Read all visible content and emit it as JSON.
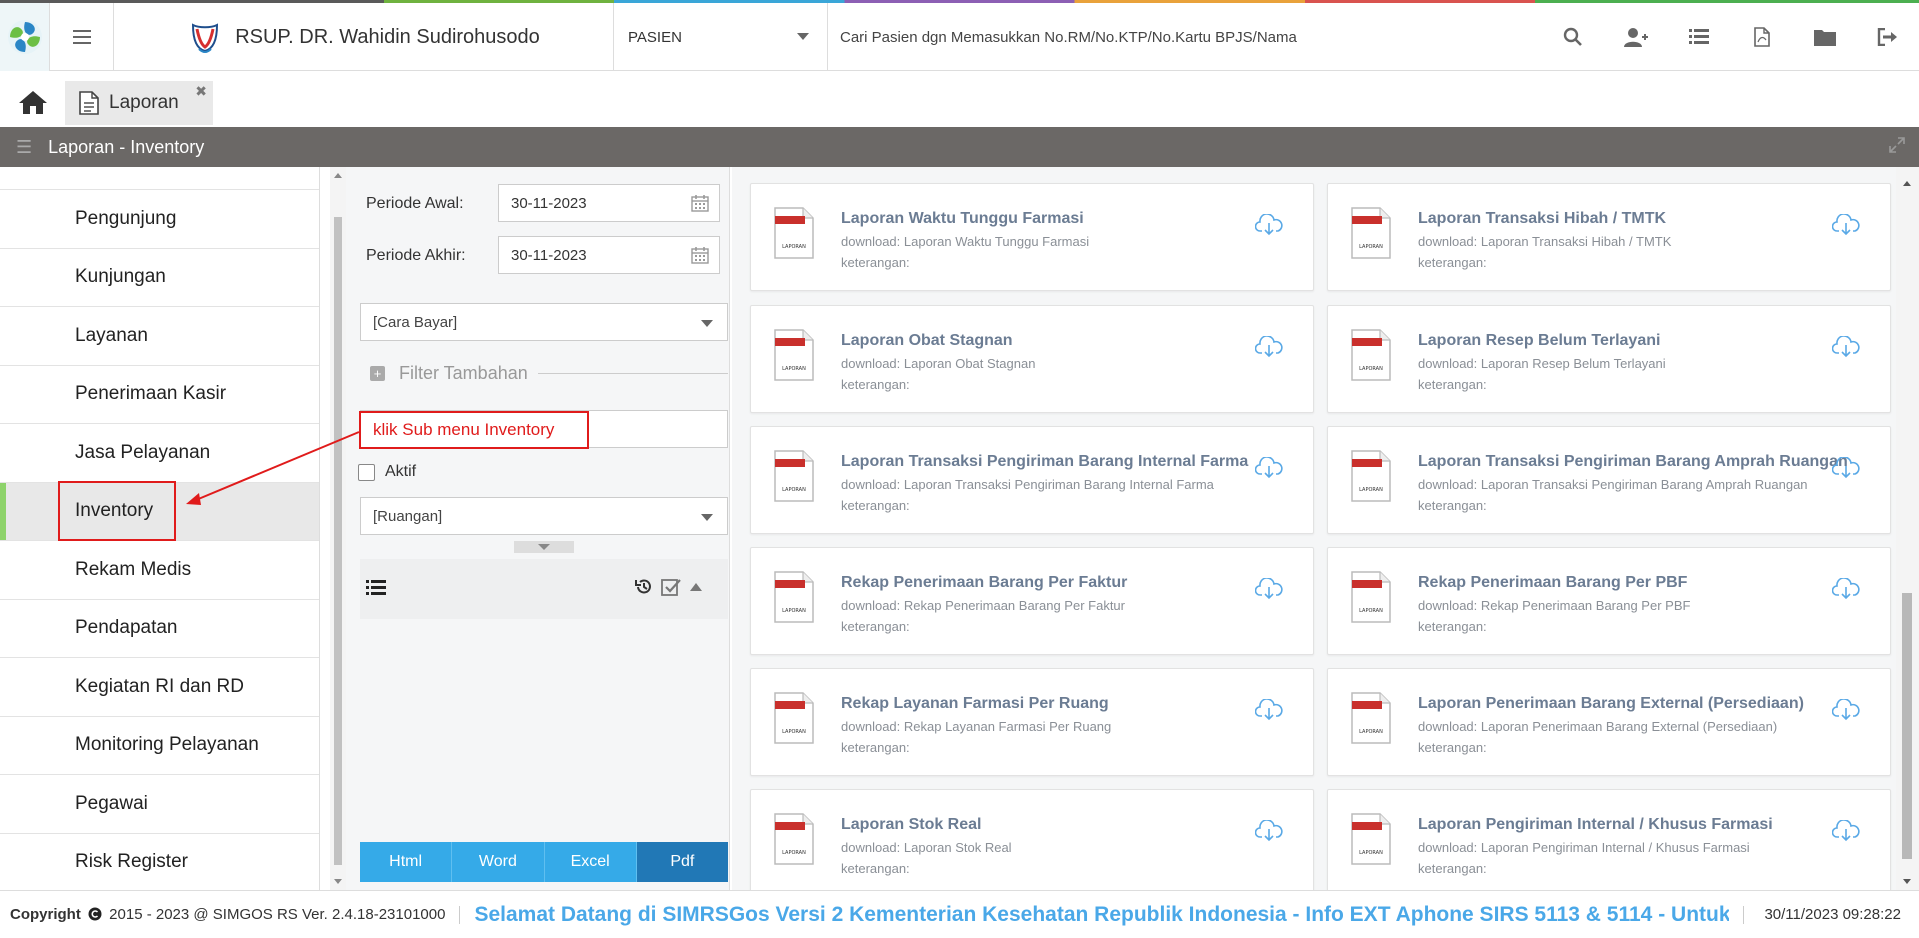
{
  "header": {
    "hospital_name": "RSUP. DR. Wahidin Sudirohusodo",
    "patient_type": "PASIEN",
    "search_placeholder": "Cari Pasien dgn Memasukkan No.RM/No.KTP/No.Kartu BPJS/Nama",
    "icons": [
      "search-icon",
      "add-user-icon",
      "list-icon",
      "pdf-file-icon",
      "folder-icon",
      "logout-icon"
    ]
  },
  "tabs": [
    {
      "label": "Laporan"
    }
  ],
  "page_title": "Laporan - Inventory",
  "sidebar": {
    "items": [
      {
        "label": "Pengunjung"
      },
      {
        "label": "Kunjungan"
      },
      {
        "label": "Layanan"
      },
      {
        "label": "Penerimaan Kasir"
      },
      {
        "label": "Jasa Pelayanan"
      },
      {
        "label": "Inventory"
      },
      {
        "label": "Rekam Medis"
      },
      {
        "label": "Pendapatan"
      },
      {
        "label": "Kegiatan RI dan RD"
      },
      {
        "label": "Monitoring Pelayanan"
      },
      {
        "label": "Pegawai"
      },
      {
        "label": "Risk Register"
      }
    ],
    "active": "Inventory"
  },
  "filters": {
    "periode_awal_label": "Periode Awal:",
    "periode_awal_value": "30-11-2023",
    "periode_akhir_label": "Periode Akhir:",
    "periode_akhir_value": "30-11-2023",
    "cara_bayar": "[Cara Bayar]",
    "filter_tambahan": "Filter Tambahan",
    "aktif_label": "Aktif",
    "ruangan": "[Ruangan]",
    "buttons": [
      "Html",
      "Word",
      "Excel",
      "Pdf"
    ]
  },
  "annotation": {
    "text": "klik Sub menu Inventory"
  },
  "reports": [
    {
      "title": "Laporan Waktu Tunggu Farmasi",
      "download": "download: Laporan Waktu Tunggu Farmasi",
      "keterangan": "keterangan:"
    },
    {
      "title": "Laporan Transaksi Hibah / TMTK",
      "download": "download: Laporan Transaksi Hibah / TMTK",
      "keterangan": "keterangan:"
    },
    {
      "title": "Laporan Obat Stagnan",
      "download": "download: Laporan Obat Stagnan",
      "keterangan": "keterangan:"
    },
    {
      "title": "Laporan Resep Belum Terlayani",
      "download": "download: Laporan Resep Belum Terlayani",
      "keterangan": "keterangan:"
    },
    {
      "title": "Laporan Transaksi Pengiriman Barang Internal Farma",
      "download": "download: Laporan Transaksi Pengiriman Barang Internal Farma",
      "keterangan": "keterangan:"
    },
    {
      "title": "Laporan Transaksi Pengiriman Barang Amprah Ruangan",
      "download": "download: Laporan Transaksi Pengiriman Barang Amprah Ruangan",
      "keterangan": "keterangan:"
    },
    {
      "title": "Rekap Penerimaan Barang Per Faktur",
      "download": "download: Rekap Penerimaan Barang Per Faktur",
      "keterangan": "keterangan:"
    },
    {
      "title": "Rekap Penerimaan Barang Per PBF",
      "download": "download: Rekap Penerimaan Barang Per PBF",
      "keterangan": "keterangan:"
    },
    {
      "title": "Rekap Layanan Farmasi Per Ruang",
      "download": "download: Rekap Layanan Farmasi Per Ruang",
      "keterangan": "keterangan:"
    },
    {
      "title": "Laporan Penerimaan Barang External (Persediaan)",
      "download": "download: Laporan Penerimaan Barang External (Persediaan)",
      "keterangan": "keterangan:"
    },
    {
      "title": "Laporan Stok Real",
      "download": "download: Laporan Stok Real",
      "keterangan": "keterangan:"
    },
    {
      "title": "Laporan Pengiriman Internal / Khusus Farmasi",
      "download": "download: Laporan Pengiriman Internal / Khusus Farmasi",
      "keterangan": "keterangan:"
    }
  ],
  "pdf_icon_text": "LAPORAN",
  "footer": {
    "copyright_label": "Copyright",
    "copyright_text": "2015 - 2023 @ SIMGOS RS Ver. 2.4.18-23101000",
    "marquee": "Selamat Datang di SIMRSGos Versi 2 Kementerian Kesehatan Republik Indonesia - Info EXT Aphone SIRS 5113 & 5114 - Untuk",
    "datetime": "30/11/2023 09:28:22"
  },
  "colors": {
    "accent_blue": "#35aae8",
    "pdf_button": "#2178b6",
    "titlebar": "#6b6866",
    "active_bar": "#8ed36b",
    "annotation_red": "#e01b1b",
    "marquee_blue": "#4aa8e8"
  }
}
